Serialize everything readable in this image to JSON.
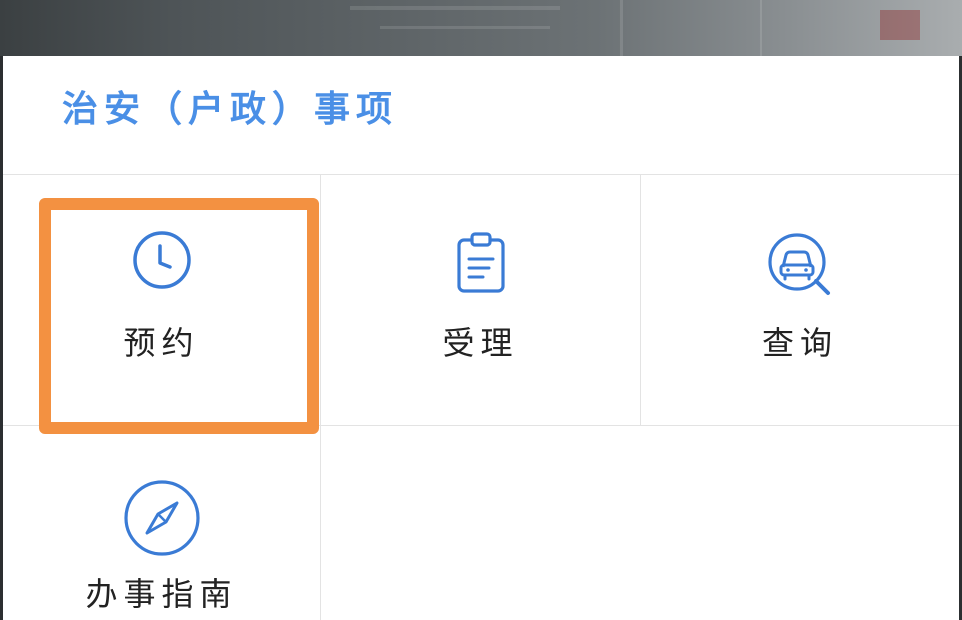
{
  "section": {
    "title": "治安（户政）事项"
  },
  "tiles": [
    {
      "label": "预约",
      "icon": "clock-icon"
    },
    {
      "label": "受理",
      "icon": "clipboard-icon"
    },
    {
      "label": "查询",
      "icon": "car-search-icon"
    },
    {
      "label": "办事指南",
      "icon": "compass-icon"
    }
  ],
  "colors": {
    "accent": "#4a8fe6",
    "icon": "#3a7bd5",
    "highlight": "#f39141",
    "divider": "#e3e3e3",
    "label": "#222222"
  }
}
